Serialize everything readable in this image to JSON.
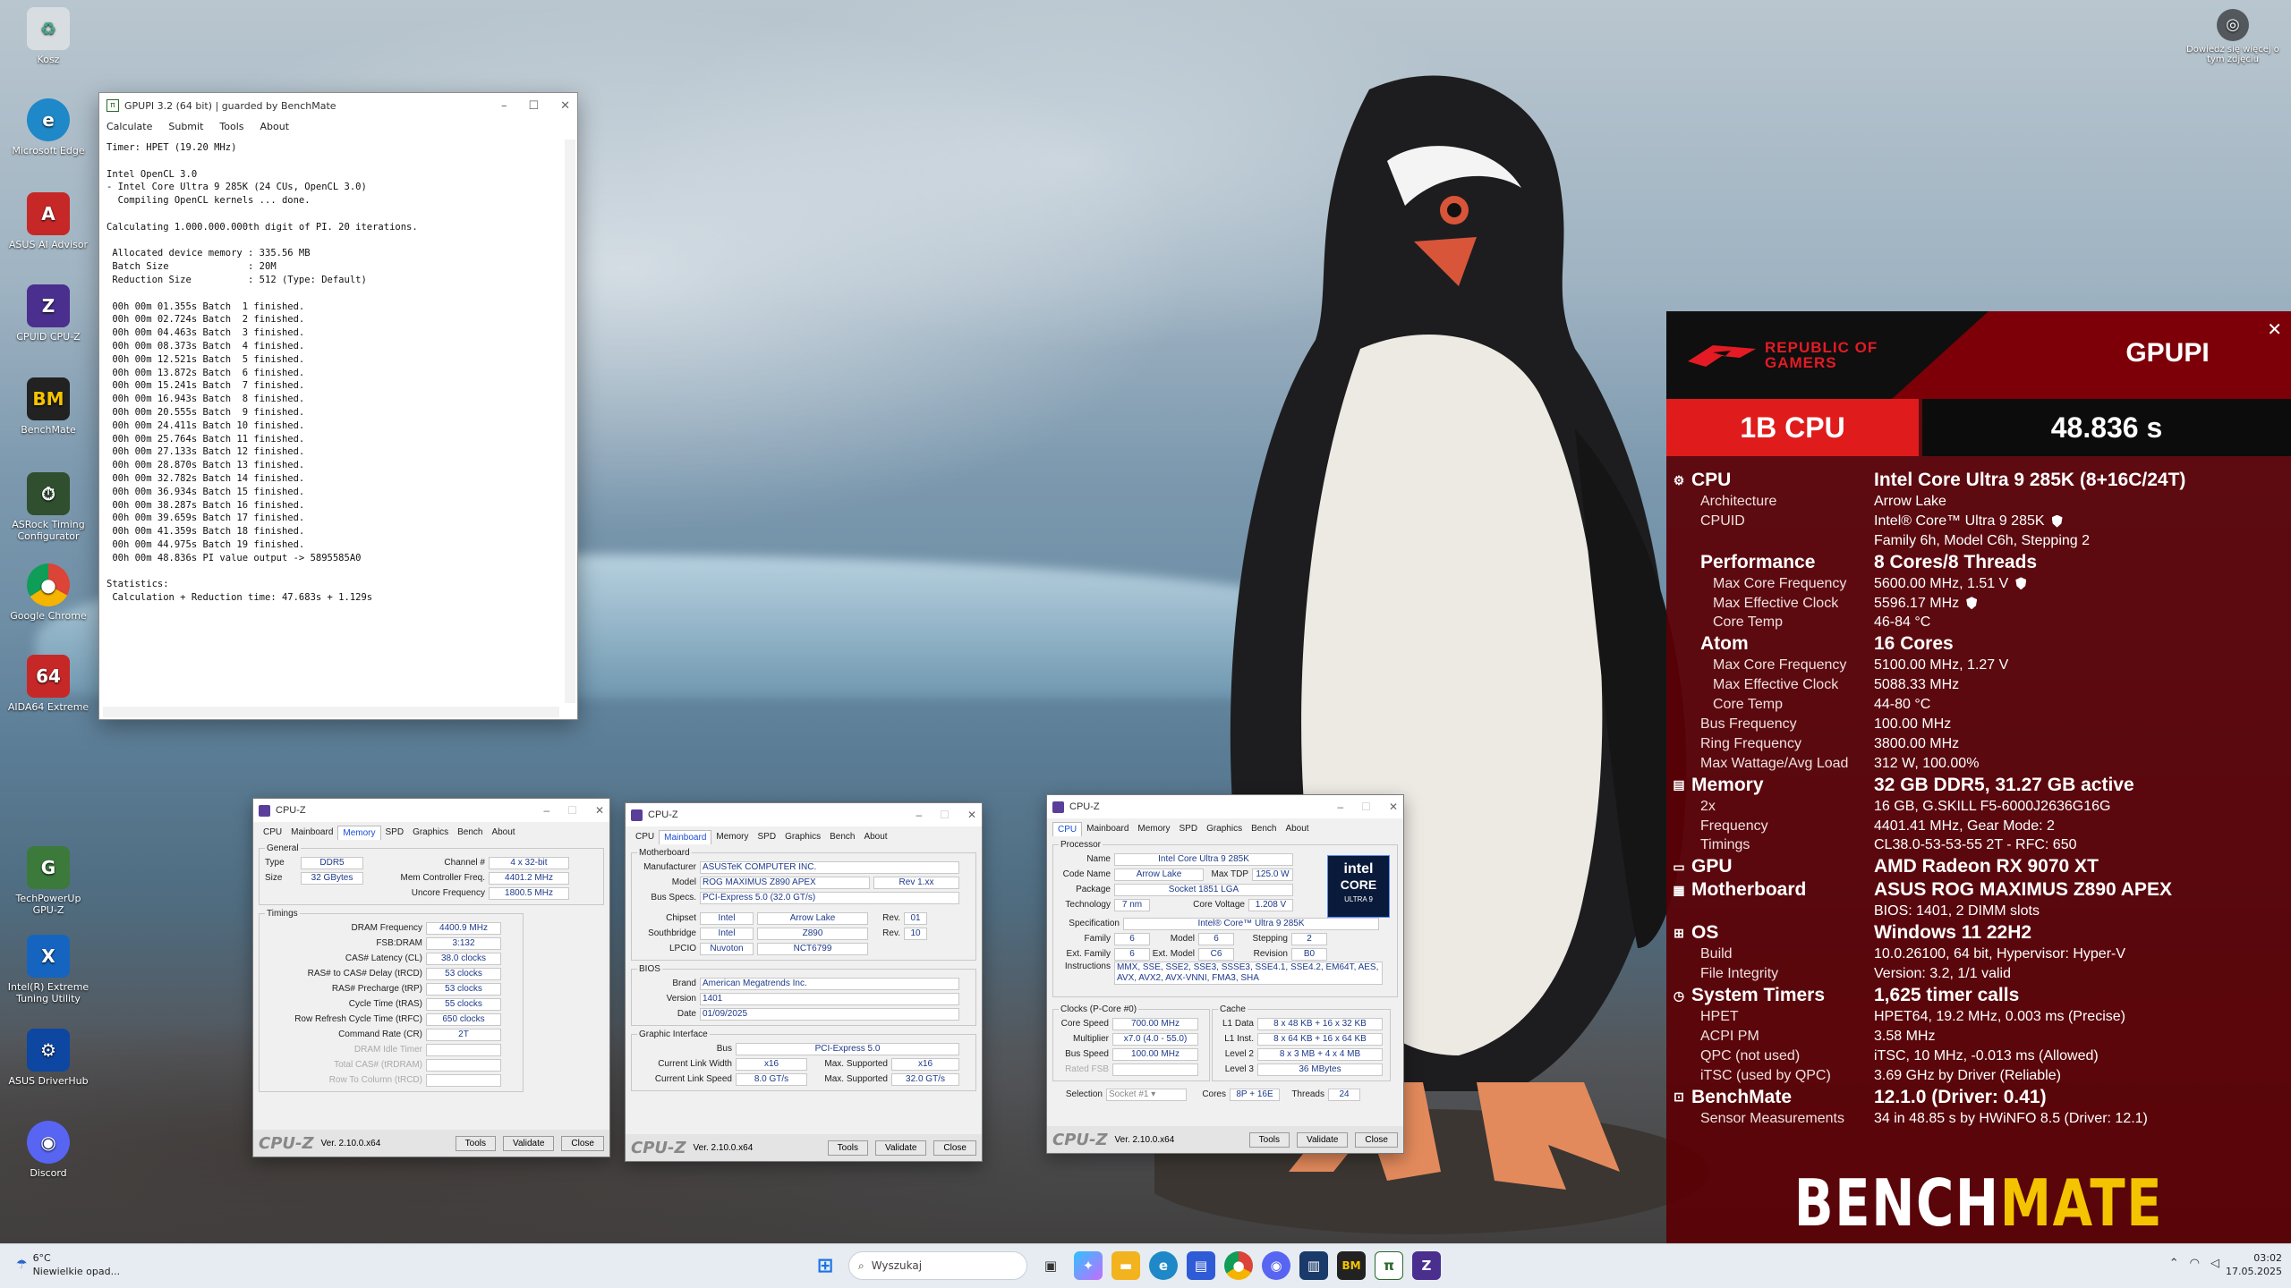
{
  "desktop_icons": [
    {
      "label": "Kosz",
      "icon": "recycle-bin-icon",
      "color": "#d8dde2"
    },
    {
      "label": "Microsoft Edge",
      "icon": "edge-icon",
      "color": "#1e88c8"
    },
    {
      "label": "ASUS AI Advisor",
      "icon": "asus-ai-advisor-icon",
      "color": "#c62828"
    },
    {
      "label": "CPUID CPU-Z",
      "icon": "cpuz-icon",
      "color": "#4a2f8e"
    },
    {
      "label": "BenchMate",
      "icon": "benchmate-icon",
      "color": "#222222"
    },
    {
      "label": "ASRock Timing Configurator",
      "icon": "asrock-icon",
      "color": "#2f4f2f"
    },
    {
      "label": "Google Chrome",
      "icon": "chrome-icon",
      "color": "#2e7d32"
    },
    {
      "label": "AIDA64 Extreme",
      "icon": "aida64-icon",
      "color": "#c62828"
    },
    {
      "label": "TechPowerUp GPU-Z",
      "icon": "gpuz-icon",
      "color": "#3b7a3b"
    },
    {
      "label": "Intel(R) Extreme Tuning Utility",
      "icon": "xtu-icon",
      "color": "#1565c0"
    },
    {
      "label": "ASUS DriverHub",
      "icon": "driverhub-icon",
      "color": "#0d47a1"
    },
    {
      "label": "Discord",
      "icon": "discord-icon",
      "color": "#5865f2"
    }
  ],
  "top_right_widget": {
    "label": "Dowiedz się więcej o tym zdjęciu",
    "icon": "camera-info-icon"
  },
  "gpupi": {
    "title": "GPUPI 3.2 (64 bit) | guarded by BenchMate",
    "menu": [
      "Calculate",
      "Submit",
      "Tools",
      "About"
    ],
    "log": "Timer: HPET (19.20 MHz)\n\nIntel OpenCL 3.0\n- Intel Core Ultra 9 285K (24 CUs, OpenCL 3.0)\n  Compiling OpenCL kernels ... done.\n\nCalculating 1.000.000.000th digit of PI. 20 iterations.\n\n Allocated device memory : 335.56 MB\n Batch Size              : 20M\n Reduction Size          : 512 (Type: Default)\n\n 00h 00m 01.355s Batch  1 finished.\n 00h 00m 02.724s Batch  2 finished.\n 00h 00m 04.463s Batch  3 finished.\n 00h 00m 08.373s Batch  4 finished.\n 00h 00m 12.521s Batch  5 finished.\n 00h 00m 13.872s Batch  6 finished.\n 00h 00m 15.241s Batch  7 finished.\n 00h 00m 16.943s Batch  8 finished.\n 00h 00m 20.555s Batch  9 finished.\n 00h 00m 24.411s Batch 10 finished.\n 00h 00m 25.764s Batch 11 finished.\n 00h 00m 27.133s Batch 12 finished.\n 00h 00m 28.870s Batch 13 finished.\n 00h 00m 32.782s Batch 14 finished.\n 00h 00m 36.934s Batch 15 finished.\n 00h 00m 38.287s Batch 16 finished.\n 00h 00m 39.659s Batch 17 finished.\n 00h 00m 41.359s Batch 18 finished.\n 00h 00m 44.975s Batch 19 finished.\n 00h 00m 48.836s PI value output -> 5895585A0\n\nStatistics:\n Calculation + Reduction time: 47.683s + 1.129s"
  },
  "cpuz_memory": {
    "title": "CPU-Z",
    "tabs": [
      "CPU",
      "Mainboard",
      "Memory",
      "SPD",
      "Graphics",
      "Bench",
      "About"
    ],
    "active_tab": "Memory",
    "general_legend": "General",
    "type_label": "Type",
    "type": "DDR5",
    "size_label": "Size",
    "size": "32 GBytes",
    "channel_label": "Channel #",
    "channel": "4 x 32-bit",
    "mcf_label": "Mem Controller Freq.",
    "mcf": "4401.2 MHz",
    "uncore_label": "Uncore Frequency",
    "uncore": "1800.5 MHz",
    "timings_legend": "Timings",
    "timings": [
      {
        "label": "DRAM Frequency",
        "value": "4400.9 MHz",
        "dim": false
      },
      {
        "label": "FSB:DRAM",
        "value": "3:132",
        "dim": false
      },
      {
        "label": "CAS# Latency (CL)",
        "value": "38.0 clocks",
        "dim": false
      },
      {
        "label": "RAS# to CAS# Delay (tRCD)",
        "value": "53 clocks",
        "dim": false
      },
      {
        "label": "RAS# Precharge (tRP)",
        "value": "53 clocks",
        "dim": false
      },
      {
        "label": "Cycle Time (tRAS)",
        "value": "55 clocks",
        "dim": false
      },
      {
        "label": "Row Refresh Cycle Time (tRFC)",
        "value": "650 clocks",
        "dim": false
      },
      {
        "label": "Command Rate (CR)",
        "value": "2T",
        "dim": false
      },
      {
        "label": "DRAM Idle Timer",
        "value": "",
        "dim": true
      },
      {
        "label": "Total CAS# (tRDRAM)",
        "value": "",
        "dim": true
      },
      {
        "label": "Row To Column (tRCD)",
        "value": "",
        "dim": true
      }
    ],
    "version": "Ver. 2.10.0.x64",
    "tools": "Tools",
    "validate": "Validate",
    "close": "Close",
    "logo": "CPU-Z"
  },
  "cpuz_mainboard": {
    "title": "CPU-Z",
    "tabs": [
      "CPU",
      "Mainboard",
      "Memory",
      "SPD",
      "Graphics",
      "Bench",
      "About"
    ],
    "active_tab": "Mainboard",
    "mb_legend": "Motherboard",
    "manufacturer_label": "Manufacturer",
    "manufacturer": "ASUSTeK COMPUTER INC.",
    "model_label": "Model",
    "model": "ROG MAXIMUS Z890 APEX",
    "rev": "Rev 1.xx",
    "busspecs_label": "Bus Specs.",
    "busspecs": "PCI-Express 5.0 (32.0 GT/s)",
    "chipset_label": "Chipset",
    "chipset_vendor": "Intel",
    "chipset": "Arrow Lake",
    "chipset_rev_label": "Rev.",
    "chipset_rev": "01",
    "southbridge_label": "Southbridge",
    "sb_vendor": "Intel",
    "sb": "Z890",
    "sb_rev_label": "Rev.",
    "sb_rev": "10",
    "lpcio_label": "LPCIO",
    "lpcio_vendor": "Nuvoton",
    "lpcio": "NCT6799",
    "bios_legend": "BIOS",
    "brand_label": "Brand",
    "brand": "American Megatrends Inc.",
    "version_label": "Version",
    "bios_version": "1401",
    "date_label": "Date",
    "date": "01/09/2025",
    "gi_legend": "Graphic Interface",
    "bus_label": "Bus",
    "bus": "PCI-Express 5.0",
    "clw_label": "Current Link Width",
    "clw": "x16",
    "maxs1_label": "Max. Supported",
    "maxs1": "x16",
    "cls_label": "Current Link Speed",
    "cls": "8.0 GT/s",
    "maxs2_label": "Max. Supported",
    "maxs2": "32.0 GT/s",
    "version": "Ver. 2.10.0.x64",
    "tools": "Tools",
    "validate": "Validate",
    "close": "Close",
    "logo": "CPU-Z"
  },
  "cpuz_cpu": {
    "title": "CPU-Z",
    "tabs": [
      "CPU",
      "Mainboard",
      "Memory",
      "SPD",
      "Graphics",
      "Bench",
      "About"
    ],
    "active_tab": "CPU",
    "proc_legend": "Processor",
    "name_label": "Name",
    "name": "Intel Core Ultra 9 285K",
    "codename_label": "Code Name",
    "codename": "Arrow Lake",
    "tdp_label": "Max TDP",
    "tdp": "125.0 W",
    "package_label": "Package",
    "package": "Socket 1851 LGA",
    "tech_label": "Technology",
    "tech": "7 nm",
    "cv_label": "Core Voltage",
    "cv": "1.208 V",
    "spec_label": "Specification",
    "spec": "Intel® Core™ Ultra 9 285K",
    "family_label": "Family",
    "family": "6",
    "model_label": "Model",
    "model": "6",
    "stepping_label": "Stepping",
    "stepping": "2",
    "extfamily_label": "Ext. Family",
    "extfamily": "6",
    "extmodel_label": "Ext. Model",
    "extmodel": "C6",
    "revision_label": "Revision",
    "revision": "B0",
    "instr_label": "Instructions",
    "instr": "MMX, SSE, SSE2, SSE3, SSSE3, SSE4.1, SSE4.2, EM64T, AES, AVX, AVX2, AVX-VNNI, FMA3, SHA",
    "clocks_legend": "Clocks (P-Core #0)",
    "corespeed_label": "Core Speed",
    "corespeed": "700.00 MHz",
    "mult_label": "Multiplier",
    "mult": "x7.0 (4.0 - 55.0)",
    "busspeed_label": "Bus Speed",
    "busspeed": "100.00 MHz",
    "ratedfsb_label": "Rated FSB",
    "ratedfsb": "",
    "cache_legend": "Cache",
    "l1d_label": "L1 Data",
    "l1d": "8 x 48 KB + 16 x 32 KB",
    "l1i_label": "L1 Inst.",
    "l1i": "8 x 64 KB + 16 x 64 KB",
    "l2_label": "Level 2",
    "l2": "8 x 3 MB + 4 x 4 MB",
    "l3_label": "Level 3",
    "l3": "36 MBytes",
    "selection_label": "Selection",
    "selection": "Socket #1",
    "cores_label": "Cores",
    "cores": "8P + 16E",
    "threads_label": "Threads",
    "threads": "24",
    "intel_badge_top": "intel",
    "intel_badge_mid": "CORE",
    "intel_badge_bot": "ULTRA 9",
    "version": "Ver. 2.10.0.x64",
    "tools": "Tools",
    "validate": "Validate",
    "close": "Close",
    "logo": "CPU-Z"
  },
  "rog": {
    "brand_line1": "REPUBLIC OF",
    "brand_line2": "GAMERS",
    "benchmark": "GPUPI",
    "score_left": "1B CPU",
    "score_right": "48.836 s",
    "cpu_title": "CPU",
    "cpu_value": "Intel Core Ultra 9 285K (8+16C/24T)",
    "arch_label": "Architecture",
    "arch": "Arrow Lake",
    "cpuid_label": "CPUID",
    "cpuid": "Intel® Core™ Ultra 9 285K",
    "cpuid2": "Family 6h, Model C6h, Stepping 2",
    "perf_title": "Performance",
    "perf_value": "8 Cores/8 Threads",
    "pmcf_label": "Max Core Frequency",
    "pmcf": "5600.00 MHz, 1.51 V",
    "pmec_label": "Max Effective Clock",
    "pmec": "5596.17 MHz",
    "pct_label": "Core Temp",
    "pct": "46-84 °C",
    "atom_title": "Atom",
    "atom_value": "16 Cores",
    "amcf_label": "Max Core Frequency",
    "amcf": "5100.00 MHz, 1.27 V",
    "amec_label": "Max Effective Clock",
    "amec": "5088.33 MHz",
    "act_label": "Core Temp",
    "act": "44-80 °C",
    "busf_label": "Bus Frequency",
    "busf": "100.00 MHz",
    "ring_label": "Ring Frequency",
    "ring": "3800.00 MHz",
    "watt_label": "Max Wattage/Avg Load",
    "watt": "312 W, 100.00%",
    "mem_title": "Memory",
    "mem_value": "32 GB DDR5, 31.27 GB active",
    "mem_cnt_label": "2x",
    "mem_cnt": "16 GB, G.SKILL F5-6000J2636G16G",
    "memf_label": "Frequency",
    "memf": "4401.41 MHz, Gear Mode: 2",
    "memt_label": "Timings",
    "memt": "CL38.0-53-53-55 2T - RFC: 650",
    "gpu_title": "GPU",
    "gpu_value": "AMD Radeon RX 9070 XT",
    "mb_title": "Motherboard",
    "mb_value": "ASUS ROG MAXIMUS Z890 APEX",
    "mb_bios": "BIOS: 1401, 2 DIMM slots",
    "os_title": "OS",
    "os_value": "Windows 11 22H2",
    "build_label": "Build",
    "build": "10.0.26100, 64 bit, Hypervisor: Hyper-V",
    "fi_label": "File Integrity",
    "fi": "Version: 3.2, 1/1 valid",
    "st_title": "System Timers",
    "st_value": "1,625 timer calls",
    "hpet_label": "HPET",
    "hpet": "HPET64, 19.2 MHz, 0.003 ms (Precise)",
    "acpi_label": "ACPI PM",
    "acpi": "3.58 MHz",
    "qpc_label": "QPC (not used)",
    "qpc": "iTSC, 10 MHz, -0.013 ms (Allowed)",
    "itsc_label": "iTSC (used by QPC)",
    "itsc": "3.69 GHz by Driver (Reliable)",
    "bm_title": "BenchMate",
    "bm_value": "12.1.0 (Driver: 0.41)",
    "sm_label": "Sensor Measurements",
    "sm": "34 in 48.85 s by HWiNFO 8.5 (Driver: 12.1)",
    "logo_bench": "BENCH",
    "logo_mate": "MATE"
  },
  "taskbar": {
    "temp": "6°C",
    "weather": "Niewielkie opad...",
    "search_placeholder": "Wyszukaj",
    "time": "03:02",
    "date": "17.05.2025"
  }
}
